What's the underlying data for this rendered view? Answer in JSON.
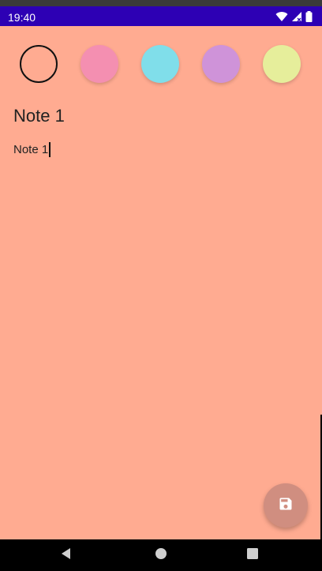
{
  "status_bar": {
    "time": "19:40",
    "icons": [
      "wifi-icon",
      "cell-signal-icon",
      "battery-icon"
    ]
  },
  "color_picker": {
    "swatches": [
      {
        "name": "salmon",
        "color": "#ffab91",
        "selected": true
      },
      {
        "name": "pink",
        "color": "#f48fb1",
        "selected": false
      },
      {
        "name": "cyan",
        "color": "#80deea",
        "selected": false
      },
      {
        "name": "purple",
        "color": "#cf93d9",
        "selected": false
      },
      {
        "name": "yellow",
        "color": "#e6ee9b",
        "selected": false
      }
    ]
  },
  "note": {
    "title": "Note 1",
    "body": "Note 1"
  },
  "fab": {
    "icon": "save-icon",
    "color": "#d08e80"
  },
  "navigation_bar": {
    "buttons": [
      "back-icon",
      "home-icon",
      "recents-icon"
    ]
  },
  "colors": {
    "background": "#ffab91",
    "status_bar": "#2d00b4"
  }
}
